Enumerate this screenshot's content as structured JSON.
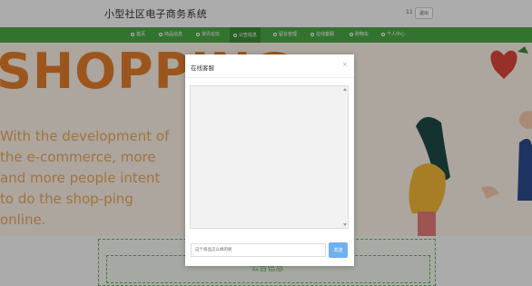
{
  "header": {
    "site_title": "小型社区电子商务系统",
    "user": "11",
    "logout_label": "退出"
  },
  "nav": {
    "items": [
      {
        "label": "首页"
      },
      {
        "label": "商品信息"
      },
      {
        "label": "资讯论坛"
      },
      {
        "label": "公告信息"
      },
      {
        "label": "留言管理"
      },
      {
        "label": "在线客服"
      },
      {
        "label": "购物车"
      },
      {
        "label": "个人中心"
      }
    ],
    "active_index": 3
  },
  "banner": {
    "headline": "SHOPPING",
    "tagline": "With the development of the e-commerce, more and more people intent to do the shop-ping online."
  },
  "notice_section": {
    "title": "公告信息"
  },
  "modal": {
    "title": "在线客服",
    "close_label": "×",
    "input_value": "这个商品怎么样的呢",
    "send_label": "发送"
  },
  "colors": {
    "nav_green": "#4aa545",
    "banner_orange": "#e07b2a",
    "send_blue": "#6fb0ef"
  }
}
